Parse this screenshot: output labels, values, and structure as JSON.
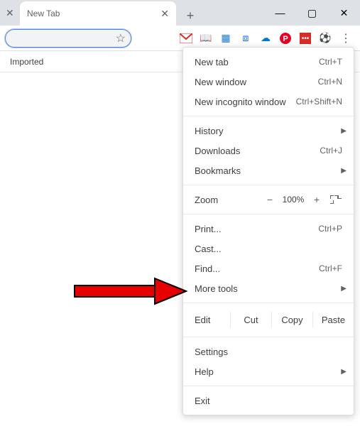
{
  "tab": {
    "title": "New Tab"
  },
  "bookmark_bar": {
    "imported": "Imported"
  },
  "zoom": {
    "label": "Zoom",
    "value": "100%"
  },
  "edit": {
    "label": "Edit",
    "cut": "Cut",
    "copy": "Copy",
    "paste": "Paste"
  },
  "menu": {
    "new_tab": {
      "label": "New tab",
      "shortcut": "Ctrl+T"
    },
    "new_window": {
      "label": "New window",
      "shortcut": "Ctrl+N"
    },
    "incognito": {
      "label": "New incognito window",
      "shortcut": "Ctrl+Shift+N"
    },
    "history": {
      "label": "History"
    },
    "downloads": {
      "label": "Downloads",
      "shortcut": "Ctrl+J"
    },
    "bookmarks": {
      "label": "Bookmarks"
    },
    "print": {
      "label": "Print...",
      "shortcut": "Ctrl+P"
    },
    "cast": {
      "label": "Cast..."
    },
    "find": {
      "label": "Find...",
      "shortcut": "Ctrl+F"
    },
    "more_tools": {
      "label": "More tools"
    },
    "settings": {
      "label": "Settings"
    },
    "help": {
      "label": "Help"
    },
    "exit": {
      "label": "Exit"
    }
  }
}
